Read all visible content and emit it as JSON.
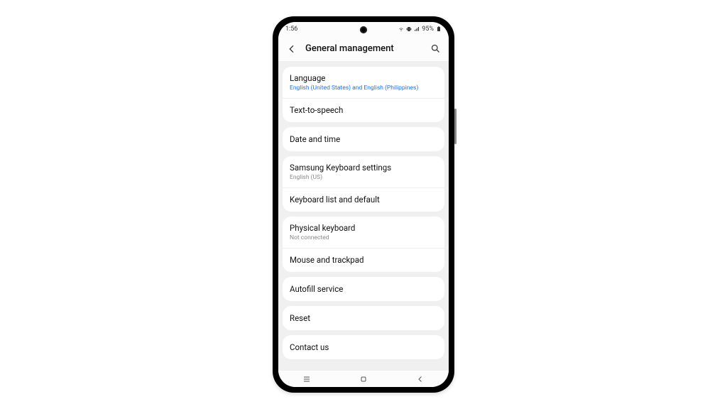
{
  "statusbar": {
    "time": "1:56",
    "battery": "95%"
  },
  "header": {
    "title": "General management"
  },
  "groups": [
    {
      "rows": [
        {
          "label": "Language",
          "sub": "English (United States) and English (Philippines)",
          "subLink": true
        },
        {
          "label": "Text-to-speech"
        }
      ]
    },
    {
      "rows": [
        {
          "label": "Date and time"
        }
      ]
    },
    {
      "rows": [
        {
          "label": "Samsung Keyboard settings",
          "sub": "English (US)"
        },
        {
          "label": "Keyboard list and default"
        }
      ]
    },
    {
      "rows": [
        {
          "label": "Physical keyboard",
          "sub": "Not connected"
        },
        {
          "label": "Mouse and trackpad"
        }
      ]
    },
    {
      "rows": [
        {
          "label": "Autofill service"
        }
      ]
    },
    {
      "rows": [
        {
          "label": "Reset"
        }
      ]
    },
    {
      "rows": [
        {
          "label": "Contact us"
        }
      ]
    }
  ]
}
